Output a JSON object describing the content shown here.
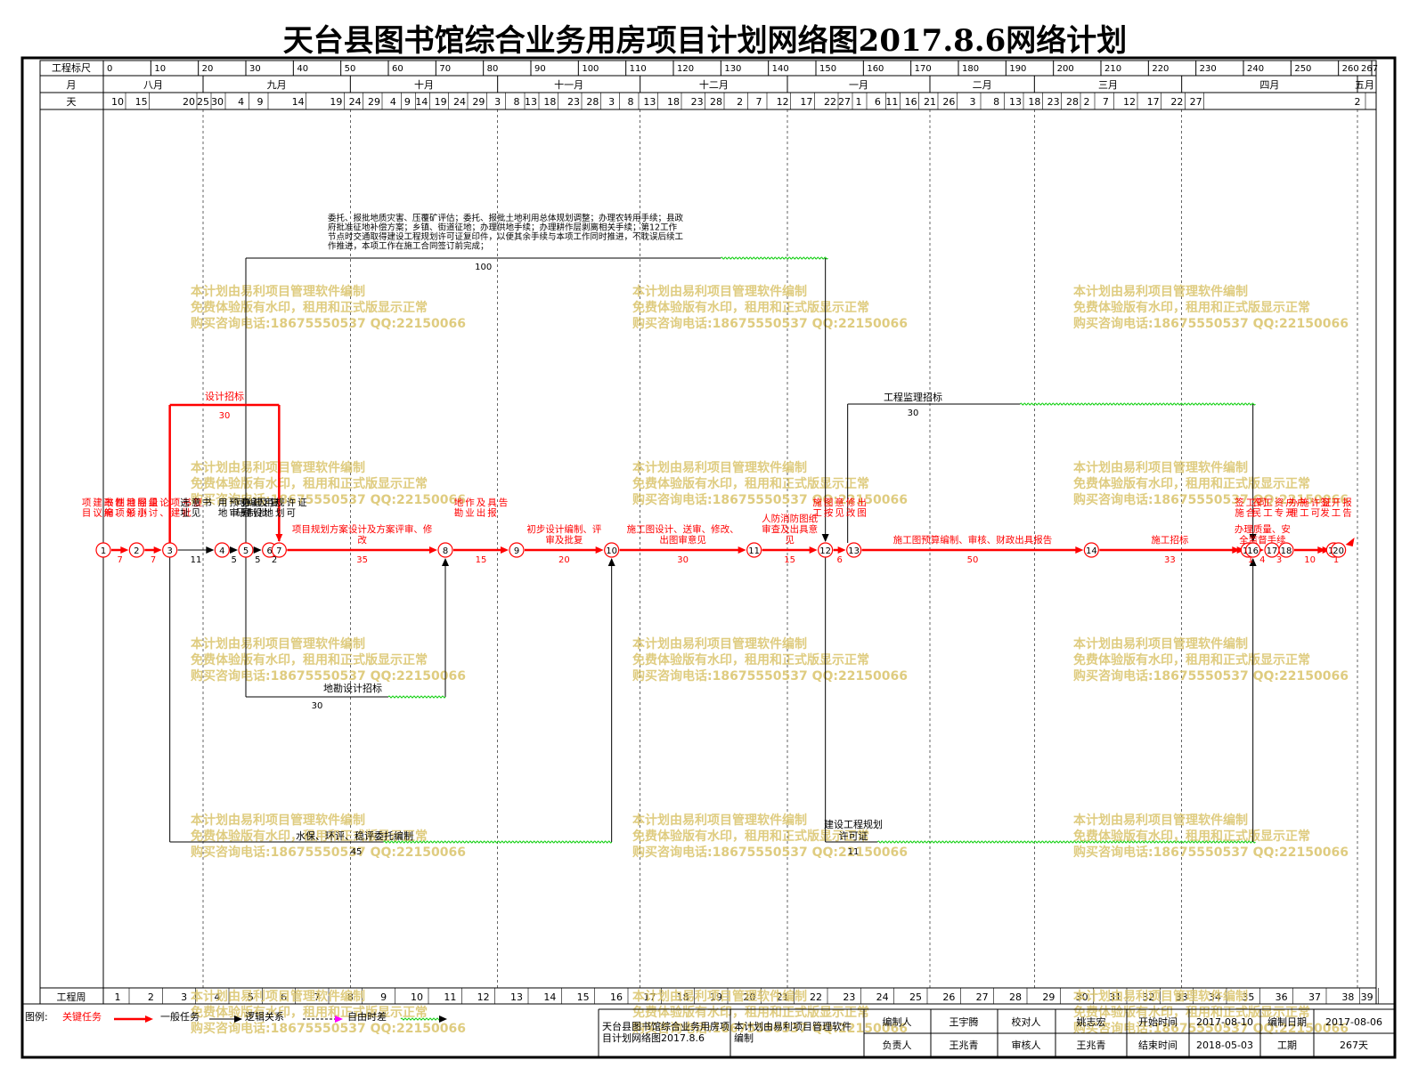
{
  "title": "天台县图书馆综合业务用房项目计划网络图2017.8.6网络计划",
  "scale": {
    "label": "工程标尺",
    "ticks": [
      0,
      10,
      20,
      30,
      40,
      50,
      60,
      70,
      80,
      90,
      100,
      110,
      120,
      130,
      140,
      150,
      160,
      170,
      180,
      190,
      200,
      210,
      220,
      230,
      240,
      250,
      260,
      267
    ]
  },
  "months": {
    "label": "月",
    "items": [
      {
        "name": "八月",
        "s": 0,
        "e": 21
      },
      {
        "name": "九月",
        "s": 21,
        "e": 52
      },
      {
        "name": "十月",
        "s": 52,
        "e": 83
      },
      {
        "name": "十一月",
        "s": 83,
        "e": 113
      },
      {
        "name": "十二月",
        "s": 113,
        "e": 144
      },
      {
        "name": "一月",
        "s": 144,
        "e": 174
      },
      {
        "name": "二月",
        "s": 174,
        "e": 196
      },
      {
        "name": "三月",
        "s": 196,
        "e": 227
      },
      {
        "name": "四月",
        "s": 227,
        "e": 264
      },
      {
        "name": "五月",
        "s": 264,
        "e": 268
      }
    ]
  },
  "days": {
    "label": "天",
    "items": [
      [
        10,
        3
      ],
      [
        15,
        8
      ],
      [
        20,
        18
      ],
      [
        25,
        21
      ],
      [
        30,
        24
      ],
      [
        4,
        29
      ],
      [
        9,
        33
      ],
      [
        14,
        41
      ],
      [
        19,
        49
      ],
      [
        24,
        53
      ],
      [
        29,
        57
      ],
      [
        4,
        61
      ],
      [
        9,
        64
      ],
      [
        14,
        67
      ],
      [
        19,
        71
      ],
      [
        24,
        75
      ],
      [
        29,
        79
      ],
      [
        3,
        83
      ],
      [
        8,
        87
      ],
      [
        13,
        90
      ],
      [
        18,
        94
      ],
      [
        23,
        99
      ],
      [
        28,
        103
      ],
      [
        3,
        107
      ],
      [
        8,
        111
      ],
      [
        13,
        115
      ],
      [
        18,
        120
      ],
      [
        23,
        125
      ],
      [
        28,
        129
      ],
      [
        2,
        134
      ],
      [
        7,
        138
      ],
      [
        12,
        143
      ],
      [
        17,
        148
      ],
      [
        22,
        153
      ],
      [
        27,
        156
      ],
      [
        1,
        159
      ],
      [
        6,
        163
      ],
      [
        11,
        166
      ],
      [
        16,
        170
      ],
      [
        21,
        174
      ],
      [
        26,
        178
      ],
      [
        3,
        183
      ],
      [
        8,
        188
      ],
      [
        13,
        192
      ],
      [
        18,
        196
      ],
      [
        23,
        200
      ],
      [
        28,
        204
      ],
      [
        2,
        207
      ],
      [
        7,
        211
      ],
      [
        12,
        216
      ],
      [
        17,
        221
      ],
      [
        22,
        226
      ],
      [
        27,
        230
      ],
      [
        2,
        264
      ]
    ]
  },
  "weeks": {
    "label": "工程周",
    "items": [
      [
        "1",
        3
      ],
      [
        "2",
        10
      ],
      [
        "3",
        17
      ],
      [
        "4",
        24
      ],
      [
        "5",
        31
      ],
      [
        "6",
        38
      ],
      [
        "7",
        45
      ],
      [
        "8",
        52
      ],
      [
        "9",
        59
      ],
      [
        "10",
        66
      ],
      [
        "11",
        73
      ],
      [
        "12",
        80
      ],
      [
        "13",
        87
      ],
      [
        "14",
        94
      ],
      [
        "15",
        101
      ],
      [
        "16",
        108
      ],
      [
        "17",
        115
      ],
      [
        "18",
        122
      ],
      [
        "19",
        129
      ],
      [
        "20",
        136
      ],
      [
        "21",
        143
      ],
      [
        "22",
        150
      ],
      [
        "23",
        157
      ],
      [
        "24",
        164
      ],
      [
        "25",
        171
      ],
      [
        "26",
        178
      ],
      [
        "27",
        185
      ],
      [
        "28",
        192
      ],
      [
        "29",
        199
      ],
      [
        "30",
        206
      ],
      [
        "31",
        213
      ],
      [
        "32",
        220
      ],
      [
        "33",
        227
      ],
      [
        "34",
        234
      ],
      [
        "35",
        241
      ],
      [
        "36",
        248
      ],
      [
        "37",
        255
      ],
      [
        "38",
        262
      ],
      [
        "39",
        266
      ]
    ]
  },
  "nodes": [
    {
      "id": "1",
      "t": 0
    },
    {
      "id": "2",
      "t": 7
    },
    {
      "id": "3",
      "t": 14
    },
    {
      "id": "4",
      "t": 25
    },
    {
      "id": "5",
      "t": 30
    },
    {
      "id": "6",
      "t": 35
    },
    {
      "id": "7",
      "t": 37
    },
    {
      "id": "8",
      "t": 72
    },
    {
      "id": "9",
      "t": 87
    },
    {
      "id": "10",
      "t": 107
    },
    {
      "id": "11",
      "t": 137
    },
    {
      "id": "12",
      "t": 152
    },
    {
      "id": "13",
      "t": 158
    },
    {
      "id": "14",
      "t": 208
    },
    {
      "id": "15",
      "t": 241
    },
    {
      "id": "16",
      "t": 242
    },
    {
      "id": "17",
      "t": 246
    },
    {
      "id": "18",
      "t": 249
    },
    {
      "id": "19",
      "t": 259
    },
    {
      "id": "20",
      "t": 260
    }
  ],
  "critical": [
    {
      "from": "1",
      "to": "2",
      "label": "项目建议书编制、地形图测量",
      "dur": "7",
      "vertical": true
    },
    {
      "from": "2",
      "to": "3",
      "label": "政府性项目领导小组讨论、项建书批复",
      "dur": "7",
      "vertical": true
    },
    {
      "from": "7",
      "to": "8",
      "label": "项目规划方案设计及方案评审、修改",
      "dur": "35",
      "vertical": false
    },
    {
      "from": "8",
      "to": "9",
      "label": "地勘作业及出具报告",
      "dur": "15",
      "vertical": true
    },
    {
      "from": "9",
      "to": "10",
      "label": "初步设计编制、评审及批复",
      "dur": "20",
      "vertical": false
    },
    {
      "from": "10",
      "to": "11",
      "label": "施工图设计、送审、修改、出图审意见",
      "dur": "30",
      "vertical": false
    },
    {
      "from": "11",
      "to": "12",
      "label": "人防消防图纸审查及出具意见",
      "dur": "15",
      "vertical": false
    },
    {
      "from": "12",
      "to": "13",
      "label": "施工图按意见修改出图",
      "dur": "6",
      "vertical": true
    },
    {
      "from": "13",
      "to": "14",
      "label": "施工图预算编制、审核、财政出具报告",
      "dur": "50",
      "vertical": false
    },
    {
      "from": "14",
      "to": "15",
      "label": "施工招标",
      "dur": "33",
      "vertical": false
    },
    {
      "from": "15",
      "to": "16",
      "label": "签施工合同",
      "dur": "1",
      "vertical": true
    },
    {
      "from": "16",
      "to": "17",
      "label": "办理质量、安全监督手续",
      "dur": "4",
      "vertical": false
    },
    {
      "from": "17",
      "to": "18",
      "label": "农民工工资专户开户",
      "dur": "3",
      "vertical": true
    },
    {
      "from": "18",
      "to": "19",
      "label": "办理施工许可证",
      "dur": "10",
      "vertical": true
    },
    {
      "from": "19",
      "to": "20",
      "label": "签发开工报告",
      "dur": "1",
      "vertical": true
    }
  ],
  "normal": [
    {
      "from": "3",
      "to": "4",
      "label": "选址意见书",
      "dur": "11",
      "vertical": true
    },
    {
      "from": "4",
      "to": "5",
      "label": "用地预审意见",
      "dur": "5",
      "vertical": true
    },
    {
      "from": "5",
      "to": "6",
      "label": "可研编制及批复",
      "dur": "5",
      "vertical": true
    },
    {
      "from": "6",
      "to": "7",
      "label": "办理建设用地规划许可证",
      "dur": "2",
      "vertical": true
    }
  ],
  "design_bid": {
    "label": "设计招标",
    "dur": "30",
    "start": 14,
    "end": 44
  },
  "big_task": {
    "text": "委托、报批地质灾害、压覆矿评估；委托、报批土地利用总体规划调整；办理农转用手续；县政府批准征地补偿方案；乡镇、街道征地；办理供地手续；办理耕作层剥离相关手续；第12工作节点时交通取得建设工程规划许可证复印件，以便其余手续与本项工作同时推进，不耽误后续工作推进，本项工作在施工合同签订前完成；",
    "dur": "100",
    "start": 30,
    "end": 130
  },
  "survey_bid": {
    "label": "地勘设计招标",
    "dur": "30",
    "start": 30,
    "end": 60
  },
  "eia": {
    "label": "水保、环评、稳评委托编制",
    "dur": "45",
    "start": 14,
    "end": 59
  },
  "permit": {
    "label": "建设工程规划许可证",
    "dur": "11",
    "start": 152,
    "end": 163
  },
  "supervision": {
    "label": "工程监理招标",
    "dur": "30",
    "start": 163,
    "end": 193
  },
  "watermark": [
    "本计划由易利项目管理软件编制",
    "免费体验版有水印，租用和正式版显示正常",
    "购买咨询电话:18675550537 QQ:22150066"
  ],
  "legend": {
    "label": "图例:",
    "critical": "关键任务",
    "normal": "一般任务",
    "logic": "逻辑关系",
    "float": "自由时差"
  },
  "footer": {
    "project": "天台县图书馆综合业务用房项目计划网络图2017.8.6",
    "software": "本计划由易利项目管理软件编制",
    "compiler_label": "编制人",
    "compiler": "王宇腾",
    "checker_label": "校对人",
    "checker": "姚志宏",
    "start_label": "开始时间",
    "start": "2017-08-10",
    "date_label": "编制日期",
    "date": "2017-08-06",
    "leader_label": "负责人",
    "leader": "王兆青",
    "reviewer_label": "审核人",
    "reviewer": "王兆青",
    "end_label": "结束时间",
    "end": "2018-05-03",
    "period_label": "工期",
    "period": "267天"
  },
  "colors": {
    "critical": "#ff0000",
    "normal": "#000000",
    "float": "#00cc00",
    "watermark": "#d9c36a",
    "grid": "#000000"
  }
}
